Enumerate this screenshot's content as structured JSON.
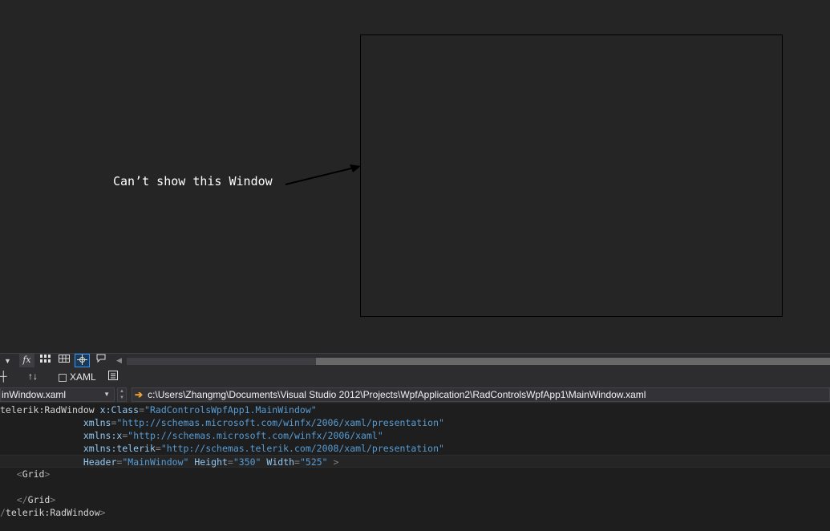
{
  "designer": {
    "annotation": "Can’t show this Window"
  },
  "toolbar1": {
    "fx_label": "fx"
  },
  "toolbar2": {
    "swap_label": "↑↓",
    "xaml_tab_label": "XAML"
  },
  "pathbar": {
    "file_combo_value": "inWindow.xaml",
    "file_path": "c:\\Users\\Zhangmg\\Documents\\Visual Studio 2012\\Projects\\WpfApplication2\\RadControlsWpfApp1\\MainWindow.xaml"
  },
  "editor": {
    "line1": {
      "open": "telerik:RadWindow",
      "attr": "x:Class",
      "value": "\"RadControlsWpfApp1.MainWindow\""
    },
    "line2": {
      "attr": "xmlns",
      "value": "\"http://schemas.microsoft.com/winfx/2006/xaml/presentation\""
    },
    "line3": {
      "attr": "xmlns:x",
      "value": "\"http://schemas.microsoft.com/winfx/2006/xaml\""
    },
    "line4": {
      "attr": "xmlns:telerik",
      "value": "\"http://schemas.telerik.com/2008/xaml/presentation\""
    },
    "line5": {
      "attr1": "Header",
      "value1": "\"MainWindow\"",
      "attr2": "Height",
      "value2": "\"350\"",
      "attr3": "Width",
      "value3": "\"525\""
    },
    "line6": {
      "element": "Grid"
    },
    "line8": {
      "element": "Grid"
    },
    "line9": {
      "element": "telerik:RadWindow"
    }
  },
  "colors": {
    "background": "#252526",
    "editor_background": "#1e1e1e",
    "attribute": "#92caf4",
    "value": "#569cd6",
    "path_arrow": "#f0a830"
  }
}
